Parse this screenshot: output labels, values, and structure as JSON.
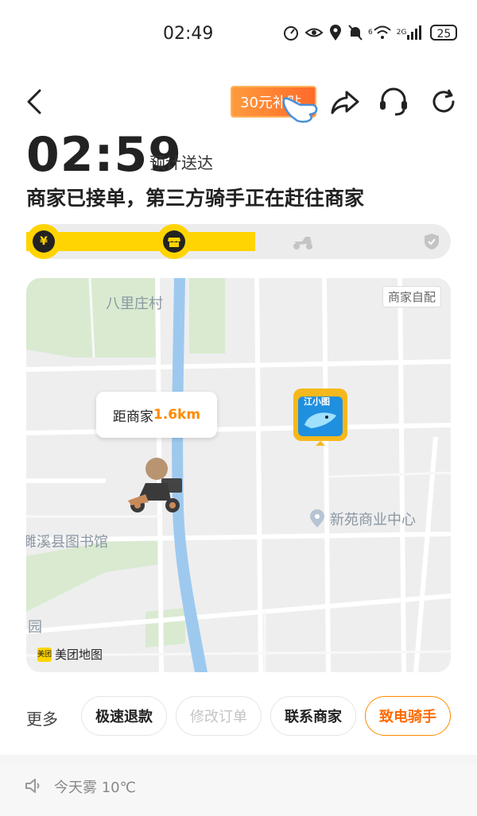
{
  "status_bar": {
    "time": "02:49",
    "battery": "25",
    "network_label": "2G",
    "wifi_label": "6"
  },
  "header": {
    "promo_text": "30元补贴",
    "icons": [
      "back-icon",
      "share-icon",
      "customer-service-icon",
      "refresh-icon"
    ]
  },
  "eta": {
    "time": "02:59",
    "label": "预计送达"
  },
  "order": {
    "status_text": "商家已接单，第三方骑手正在赶往商家",
    "progress_steps": [
      {
        "name": "paid",
        "icon": "yen-icon",
        "active": true
      },
      {
        "name": "merchant",
        "icon": "shop-icon",
        "active": true
      },
      {
        "name": "delivering",
        "icon": "scooter-icon",
        "active": false
      },
      {
        "name": "delivered",
        "icon": "check-icon",
        "active": false
      }
    ],
    "progress_fraction": 0.5
  },
  "map": {
    "labels": {
      "village": "八里庄村",
      "library": "濉溪县图书馆",
      "commercial_center": "新苑商业中心",
      "park_fragment": "园"
    },
    "self_pickup_tag": "商家自配",
    "store_sign": "江小图",
    "distance_prefix": "距商家",
    "distance_value": "1.6km",
    "brand_logo_text": "美团",
    "brand": "美团地图"
  },
  "actions": {
    "more_label": "更多",
    "buttons": [
      {
        "label": "极速退款",
        "state": "normal"
      },
      {
        "label": "修改订单",
        "state": "disabled"
      },
      {
        "label": "联系商家",
        "state": "normal"
      },
      {
        "label": "致电骑手",
        "state": "accent"
      }
    ]
  },
  "weather": {
    "text": "今天雾 10℃"
  },
  "colors": {
    "accent_yellow": "#ffd400",
    "accent_orange": "#ff8a00",
    "river": "#9ec9ef",
    "green_area": "#d9ead0"
  }
}
